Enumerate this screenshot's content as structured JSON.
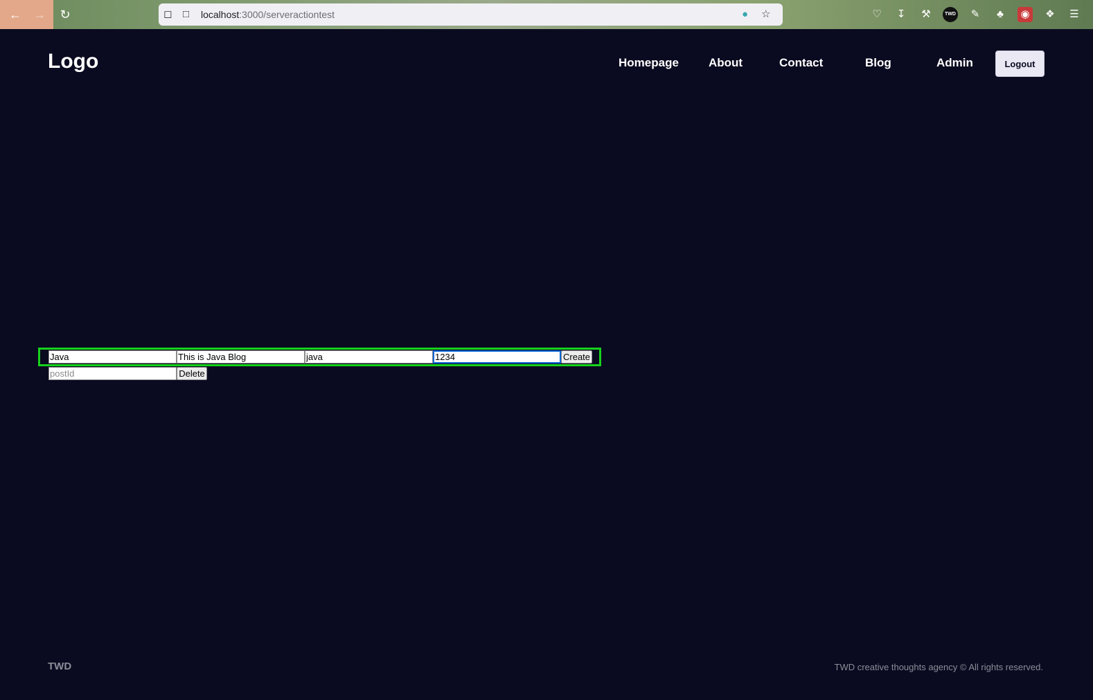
{
  "browser": {
    "url_host": "localhost",
    "url_path": ":3000/serveractiontest",
    "icons": [
      "back-arrow-icon",
      "forward-arrow-icon",
      "reload-icon",
      "shield-icon",
      "page-icon",
      "extension-icon",
      "star-icon",
      "pocket-icon",
      "download-icon",
      "wrench-icon",
      "twd-extension-icon",
      "notes-icon",
      "gnome-icon",
      "red-extension-icon",
      "puzzle-icon",
      "menu-icon"
    ],
    "twd_badge": "TWD"
  },
  "header": {
    "logo": "Logo",
    "nav": [
      "Homepage",
      "About",
      "Contact",
      "Blog",
      "Admin"
    ],
    "logout_label": "Logout"
  },
  "create_form": {
    "title_value": "Java",
    "description_value": "This is Java Blog",
    "slug_value": "java",
    "user_id_value": "1234",
    "submit_label": "Create",
    "highlight_color": "#16d21b"
  },
  "delete_form": {
    "post_id_placeholder": "postId",
    "submit_label": "Delete"
  },
  "footer": {
    "brand": "TWD",
    "copyright": "TWD creative thoughts agency © All rights reserved."
  },
  "colors": {
    "background": "#0a0b20",
    "text": "#ffffff",
    "muted": "#8c8c99",
    "focus": "#0a66d6"
  }
}
